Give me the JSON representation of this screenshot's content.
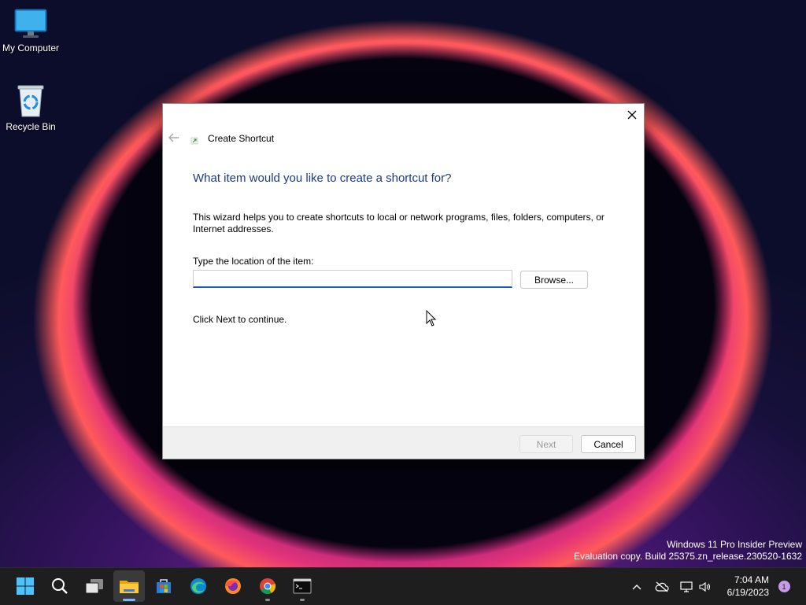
{
  "desktop": {
    "icons": [
      {
        "label": "My Computer",
        "icon": "monitor-icon"
      },
      {
        "label": "Recycle Bin",
        "icon": "recycle-bin-icon"
      }
    ]
  },
  "dialog": {
    "title": "Create Shortcut",
    "heading": "What item would you like to create a shortcut for?",
    "description": "This wizard helps you to create shortcuts to local or network programs, files, folders, computers, or Internet addresses.",
    "location_label": "Type the location of the item:",
    "location_value": "",
    "location_placeholder": "",
    "browse_label": "Browse...",
    "continue_text": "Click Next to continue.",
    "next_label": "Next",
    "cancel_label": "Cancel"
  },
  "watermark": {
    "line1": "Windows 11 Pro Insider Preview",
    "line2": "Evaluation copy. Build 25375.zn_release.230520-1632"
  },
  "taskbar": {
    "apps": [
      {
        "name": "start",
        "icon": "windows-logo-icon"
      },
      {
        "name": "search",
        "icon": "search-icon"
      },
      {
        "name": "task-view",
        "icon": "task-view-icon"
      },
      {
        "name": "file-explorer",
        "icon": "folder-icon",
        "active": true
      },
      {
        "name": "store",
        "icon": "store-icon"
      },
      {
        "name": "edge",
        "icon": "edge-icon"
      },
      {
        "name": "firefox",
        "icon": "firefox-icon"
      },
      {
        "name": "chrome",
        "icon": "chrome-icon",
        "running": true
      },
      {
        "name": "terminal",
        "icon": "terminal-icon",
        "running": true
      }
    ],
    "clock_time": "7:04 AM",
    "clock_date": "6/19/2023",
    "notification_count": "1"
  },
  "colors": {
    "heading": "#1c3a8a",
    "accent": "#1f5aa6",
    "taskbar": "#1e1e1e"
  }
}
